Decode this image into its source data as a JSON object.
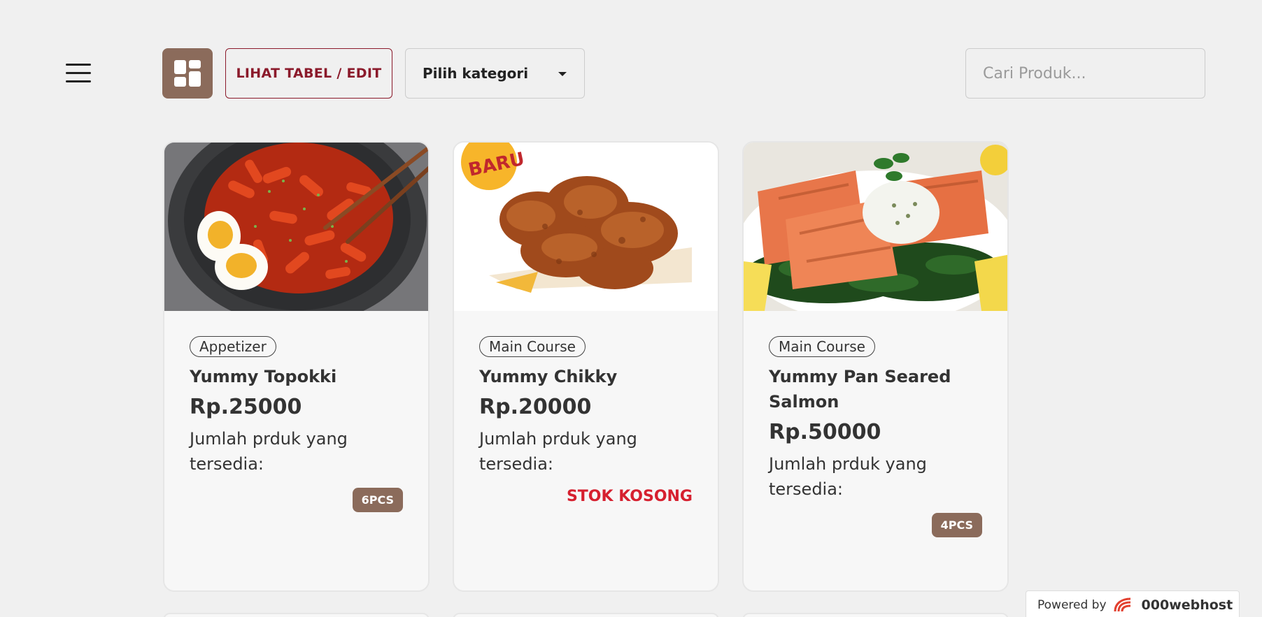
{
  "header": {
    "menu_icon": "hamburger-icon",
    "view_icon": "dashboard-grid-icon",
    "table_button_label": "LIHAT TABEL / EDIT",
    "category_select": {
      "selected": "Pilih kategori"
    },
    "search": {
      "placeholder": "Cari Produk...",
      "value": ""
    }
  },
  "products": [
    {
      "category": "Appetizer",
      "name": "Yummy Topokki",
      "price": "Rp.25000",
      "stock_label": "Jumlah prduk yang tersedia:",
      "stock_status": "6PCS"
    },
    {
      "category": "Main Course",
      "name": "Yummy Chikky",
      "price": "Rp.20000",
      "stock_label": "Jumlah prduk yang tersedia:",
      "stock_status": "STOK KOSONG",
      "image_badge": "BARU"
    },
    {
      "category": "Main Course",
      "name": "Yummy Pan Seared Salmon",
      "price": "Rp.50000",
      "stock_label": "Jumlah prduk yang tersedia:",
      "stock_status": "4PCS"
    }
  ],
  "footer": {
    "powered_by": "Powered by",
    "brand": "000webhost"
  },
  "colors": {
    "accent_brown": "#8b6b5b",
    "accent_maroon": "#8b1a2b",
    "out_of_stock_red": "#d6202f",
    "background": "#f0f0f0"
  }
}
